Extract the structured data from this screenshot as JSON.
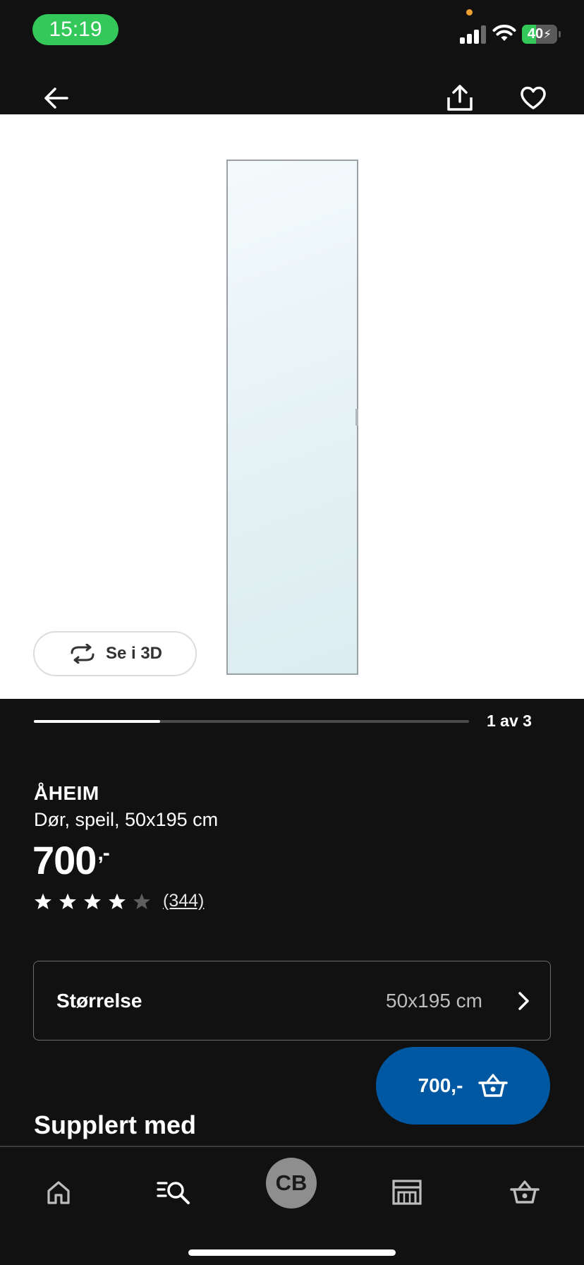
{
  "status_bar": {
    "time": "15:19",
    "battery_percent": 40,
    "battery_label": "40",
    "signal_bars": 3
  },
  "top_nav": {
    "icons": [
      "arrow-left-icon",
      "share-icon",
      "heart-icon"
    ]
  },
  "gallery": {
    "view_3d_label": "Se i 3D",
    "current_image": 1,
    "total_images": 3,
    "pager_label": "1 av 3",
    "progress_fraction": 0.29
  },
  "product": {
    "name": "ÅHEIM",
    "description": "Dør, speil, 50x195 cm",
    "price": "700",
    "price_suffix": ",-",
    "rating": 4,
    "rating_max": 5,
    "review_count": "(344)"
  },
  "size_selector": {
    "label": "Størrelse",
    "value": "50x195 cm"
  },
  "cart_button": {
    "label": "700,-"
  },
  "section": {
    "heading": "Supplert med"
  },
  "tab_bar": {
    "items": [
      "home-icon",
      "search-icon",
      "profile-avatar",
      "store-icon",
      "basket-icon"
    ],
    "avatar_initials": "CB"
  },
  "colors": {
    "background": "#111111",
    "primary_blue": "#0058a3",
    "status_green": "#34c759",
    "image_background": "#ffffff"
  }
}
